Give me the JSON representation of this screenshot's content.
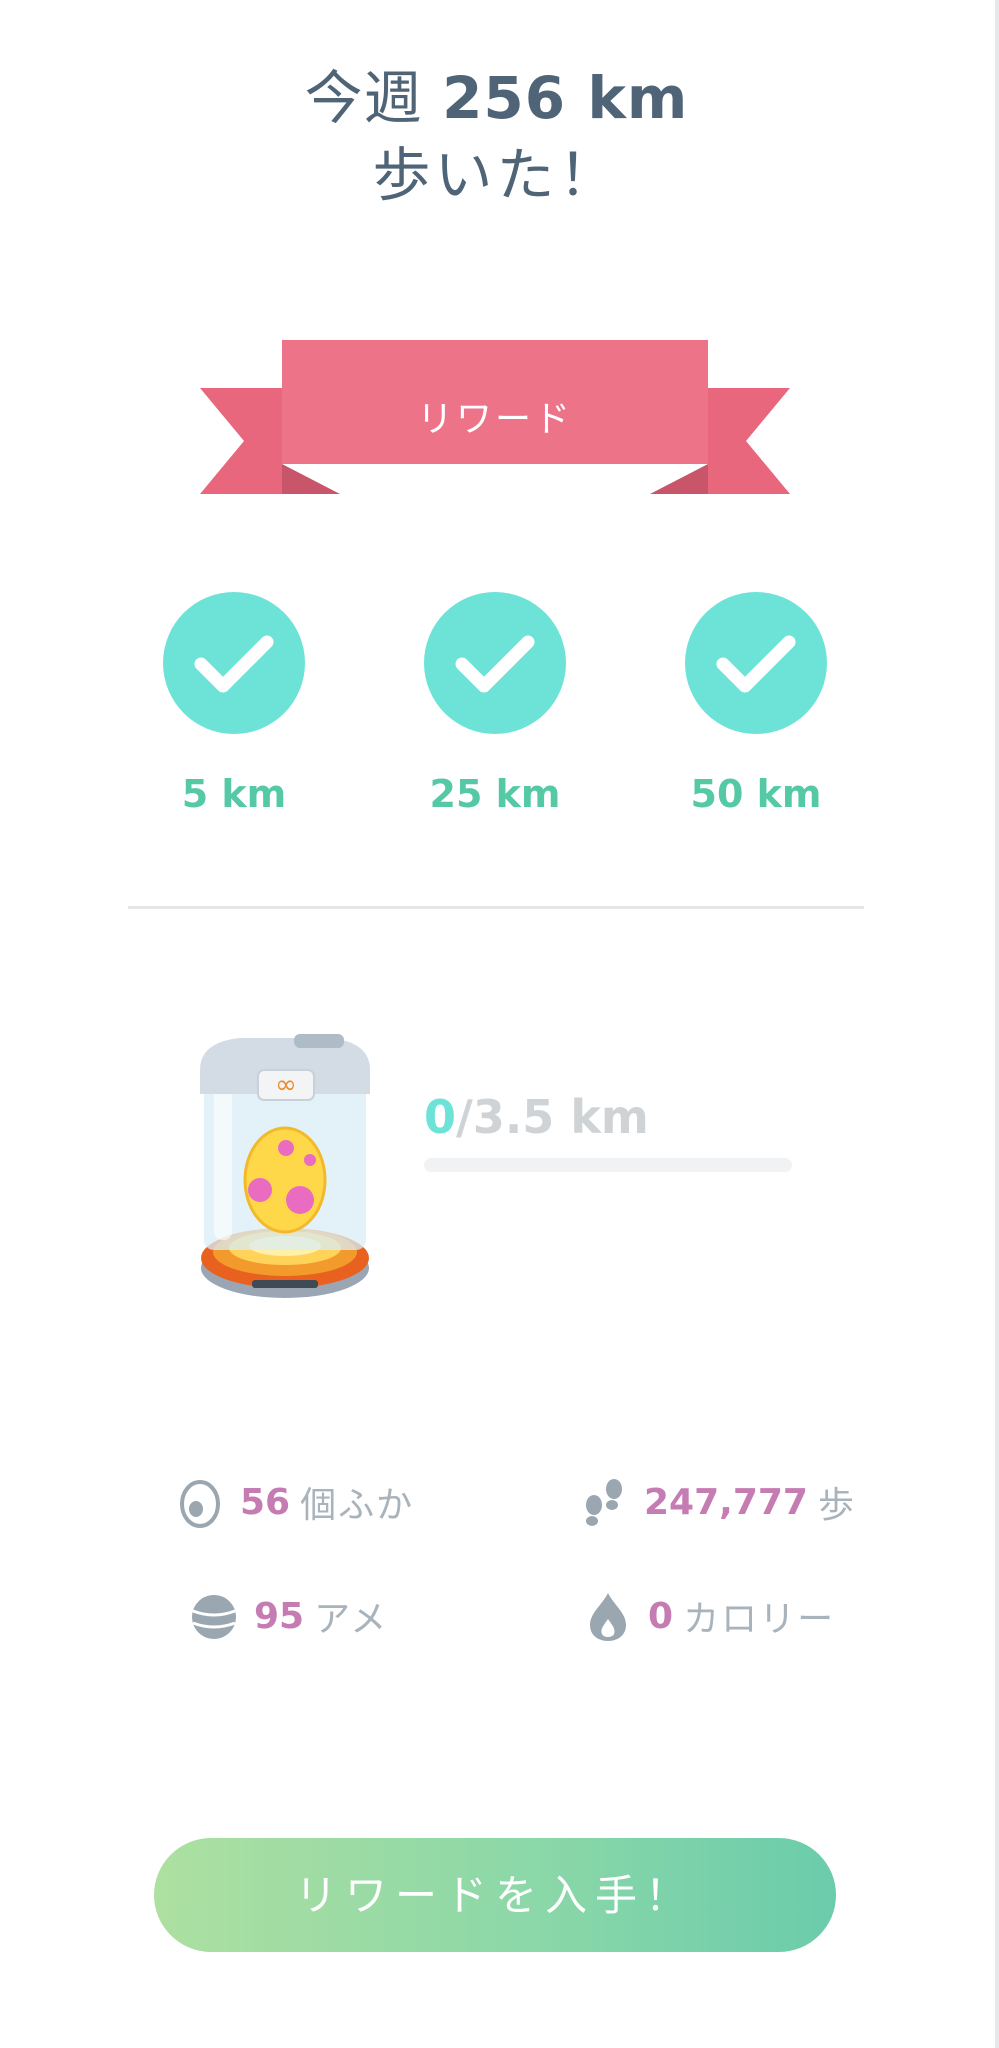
{
  "header": {
    "prefix": "今週",
    "distance": "256 km",
    "line2": "歩いた！"
  },
  "ribbon": {
    "label": "リワード",
    "color": "#ed7389"
  },
  "milestones": [
    {
      "label": "5 km",
      "completed": true
    },
    {
      "label": "25 km",
      "completed": true
    },
    {
      "label": "50 km",
      "completed": true
    }
  ],
  "incubator": {
    "icon": "incubator-egg-icon",
    "current": "0",
    "total": "/3.5 km",
    "progress": 0
  },
  "stats": {
    "hatched": {
      "value": "56",
      "unit": "個ふか",
      "icon": "egg-icon"
    },
    "steps": {
      "value": "247,777",
      "unit": "歩",
      "icon": "footprints-icon"
    },
    "candy": {
      "value": "95",
      "unit": "アメ",
      "icon": "candy-icon"
    },
    "calories": {
      "value": "0",
      "unit": "カロリー",
      "icon": "flame-icon"
    }
  },
  "claim_button": {
    "label": "リワードを入手！"
  },
  "colors": {
    "accent_teal": "#6de3d8",
    "milestone_text": "#55c9a6",
    "stat_value": "#c57cb2",
    "header_text": "#4f6577"
  }
}
